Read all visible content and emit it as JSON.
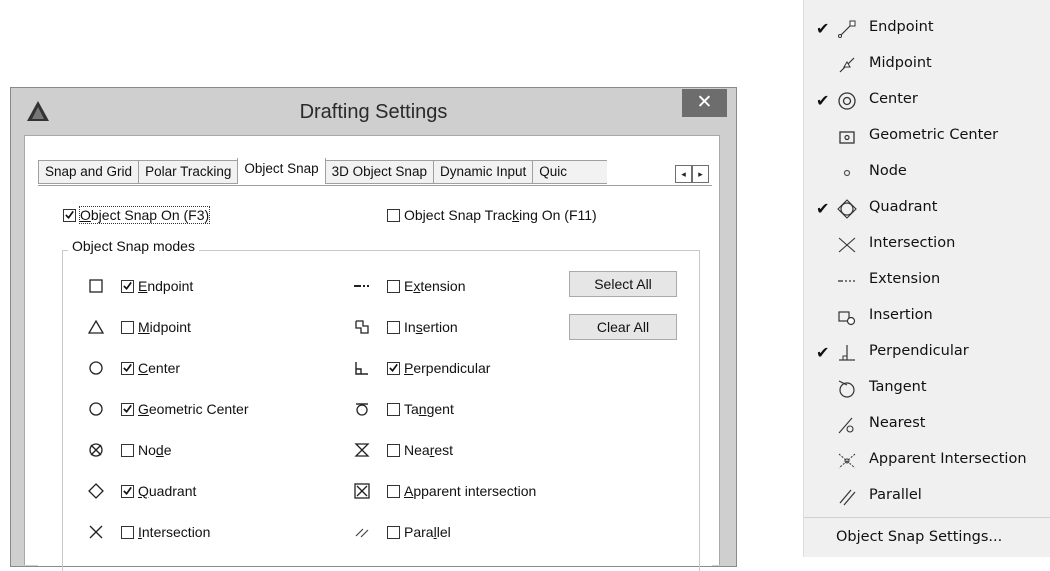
{
  "dialog": {
    "title": "Drafting Settings",
    "close_label": "✕",
    "tabs": [
      "Snap and Grid",
      "Polar Tracking",
      "Object Snap",
      "3D Object Snap",
      "Dynamic Input",
      "Quic"
    ],
    "active_tab": "Object Snap",
    "tab_scroll_left": "◂",
    "tab_scroll_right": "▸",
    "snap_on": {
      "label_pre": "",
      "label_ul": "O",
      "label_post": "bject Snap On (F3)",
      "checked": true
    },
    "tracking_on": {
      "label_pre": "Object Snap Trac",
      "label_ul": "k",
      "label_post": "ing On (F11)",
      "checked": false
    },
    "group_title": "Object Snap modes",
    "modes_left": [
      {
        "icon": "square-icon",
        "pre": "",
        "ul": "E",
        "post": "ndpoint",
        "checked": true
      },
      {
        "icon": "triangle-icon",
        "pre": "",
        "ul": "M",
        "post": "idpoint",
        "checked": false
      },
      {
        "icon": "circle-icon",
        "pre": "",
        "ul": "C",
        "post": "enter",
        "checked": true
      },
      {
        "icon": "circle-icon",
        "pre": "",
        "ul": "G",
        "post": "eometric Center",
        "checked": true
      },
      {
        "icon": "node-icon",
        "pre": "No",
        "ul": "d",
        "post": "e",
        "checked": false
      },
      {
        "icon": "diamond-icon",
        "pre": "",
        "ul": "Q",
        "post": "uadrant",
        "checked": true
      },
      {
        "icon": "x-icon",
        "pre": "",
        "ul": "I",
        "post": "ntersection",
        "checked": false
      }
    ],
    "modes_right": [
      {
        "icon": "extension-icon",
        "pre": "E",
        "ul": "x",
        "post": "tension",
        "checked": false
      },
      {
        "icon": "insertion-icon",
        "pre": "In",
        "ul": "s",
        "post": "ertion",
        "checked": false
      },
      {
        "icon": "perpendicular-icon",
        "pre": "",
        "ul": "P",
        "post": "erpendicular",
        "checked": true
      },
      {
        "icon": "tangent-icon",
        "pre": "Ta",
        "ul": "n",
        "post": "gent",
        "checked": false
      },
      {
        "icon": "nearest-icon",
        "pre": "Nea",
        "ul": "r",
        "post": "est",
        "checked": false
      },
      {
        "icon": "apparent-intersection-icon",
        "pre": "",
        "ul": "A",
        "post": "pparent intersection",
        "checked": false
      },
      {
        "icon": "parallel-icon",
        "pre": "Para",
        "ul": "l",
        "post": "lel",
        "checked": false
      }
    ],
    "select_all_label": "Select All",
    "clear_all_label": "Clear All"
  },
  "menu": {
    "items": [
      {
        "label": "Endpoint",
        "checked": true,
        "icon": "endpoint-icon"
      },
      {
        "label": "Midpoint",
        "checked": false,
        "icon": "midpoint-icon"
      },
      {
        "label": "Center",
        "checked": true,
        "icon": "center-icon"
      },
      {
        "label": "Geometric Center",
        "checked": false,
        "icon": "geometric-center-icon"
      },
      {
        "label": "Node",
        "checked": false,
        "icon": "node-icon"
      },
      {
        "label": "Quadrant",
        "checked": true,
        "icon": "quadrant-icon"
      },
      {
        "label": "Intersection",
        "checked": false,
        "icon": "intersection-icon"
      },
      {
        "label": "Extension",
        "checked": false,
        "icon": "extension-icon"
      },
      {
        "label": "Insertion",
        "checked": false,
        "icon": "insertion-icon"
      },
      {
        "label": "Perpendicular",
        "checked": true,
        "icon": "perpendicular-icon"
      },
      {
        "label": "Tangent",
        "checked": false,
        "icon": "tangent-icon"
      },
      {
        "label": "Nearest",
        "checked": false,
        "icon": "nearest-icon"
      },
      {
        "label": "Apparent Intersection",
        "checked": false,
        "icon": "apparent-intersection-icon"
      },
      {
        "label": "Parallel",
        "checked": false,
        "icon": "parallel-icon"
      }
    ],
    "check_mark": "✔",
    "settings_label": "Object Snap Settings..."
  }
}
